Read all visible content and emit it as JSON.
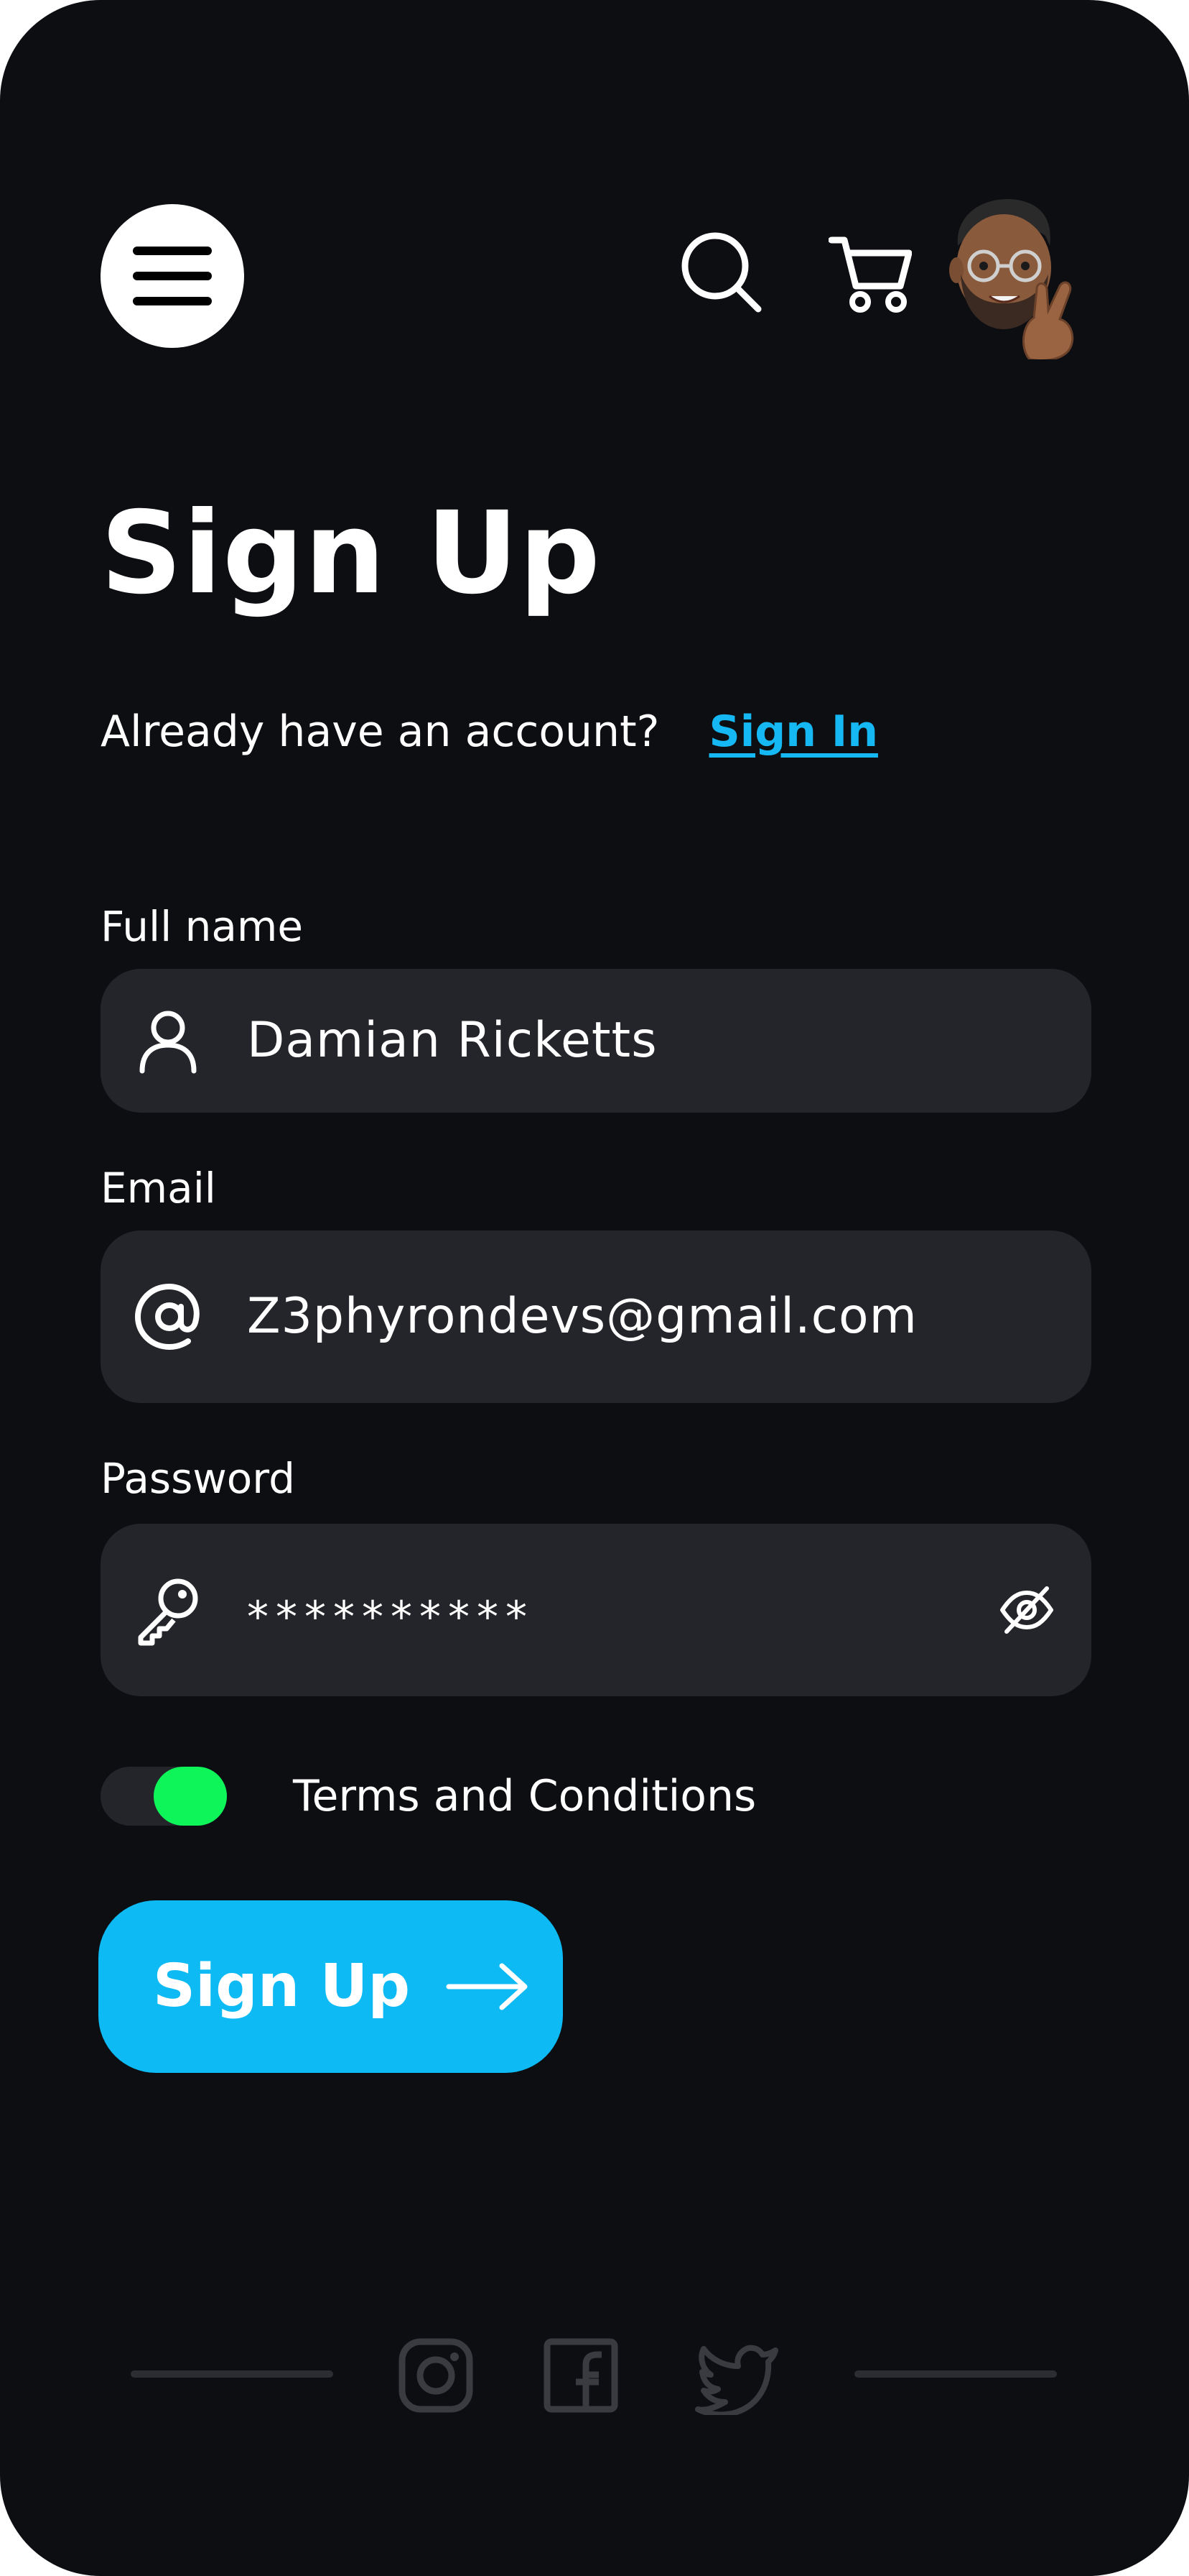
{
  "header": {
    "menu_icon": "hamburger-menu-icon",
    "search_icon": "search-icon",
    "cart_icon": "shopping-cart-icon",
    "avatar_icon": "memoji-avatar-peace-sign"
  },
  "page": {
    "title": "Sign Up",
    "account_question": "Already have an account?",
    "signin_link": "Sign In"
  },
  "form": {
    "full_name": {
      "label": "Full name",
      "value": "Damian Ricketts",
      "icon": "user-icon"
    },
    "email": {
      "label": "Email",
      "value": "Z3phyrondevs@gmail.com",
      "icon": "at-sign-icon"
    },
    "password": {
      "label": "Password",
      "value": "**********",
      "icon": "key-icon",
      "visibility_icon": "eye-off-icon"
    },
    "terms": {
      "label": "Terms and Conditions",
      "enabled": true
    },
    "submit_label": "Sign Up",
    "submit_icon": "arrow-right-icon"
  },
  "footer": {
    "social": [
      "instagram-icon",
      "facebook-icon",
      "twitter-icon"
    ]
  },
  "colors": {
    "background": "#0d0e12",
    "field": "#24252a",
    "accent": "#0dbaf4",
    "link": "#15b8f2",
    "toggle_on": "#0ef55a",
    "footer_icon": "#3a3b41"
  }
}
